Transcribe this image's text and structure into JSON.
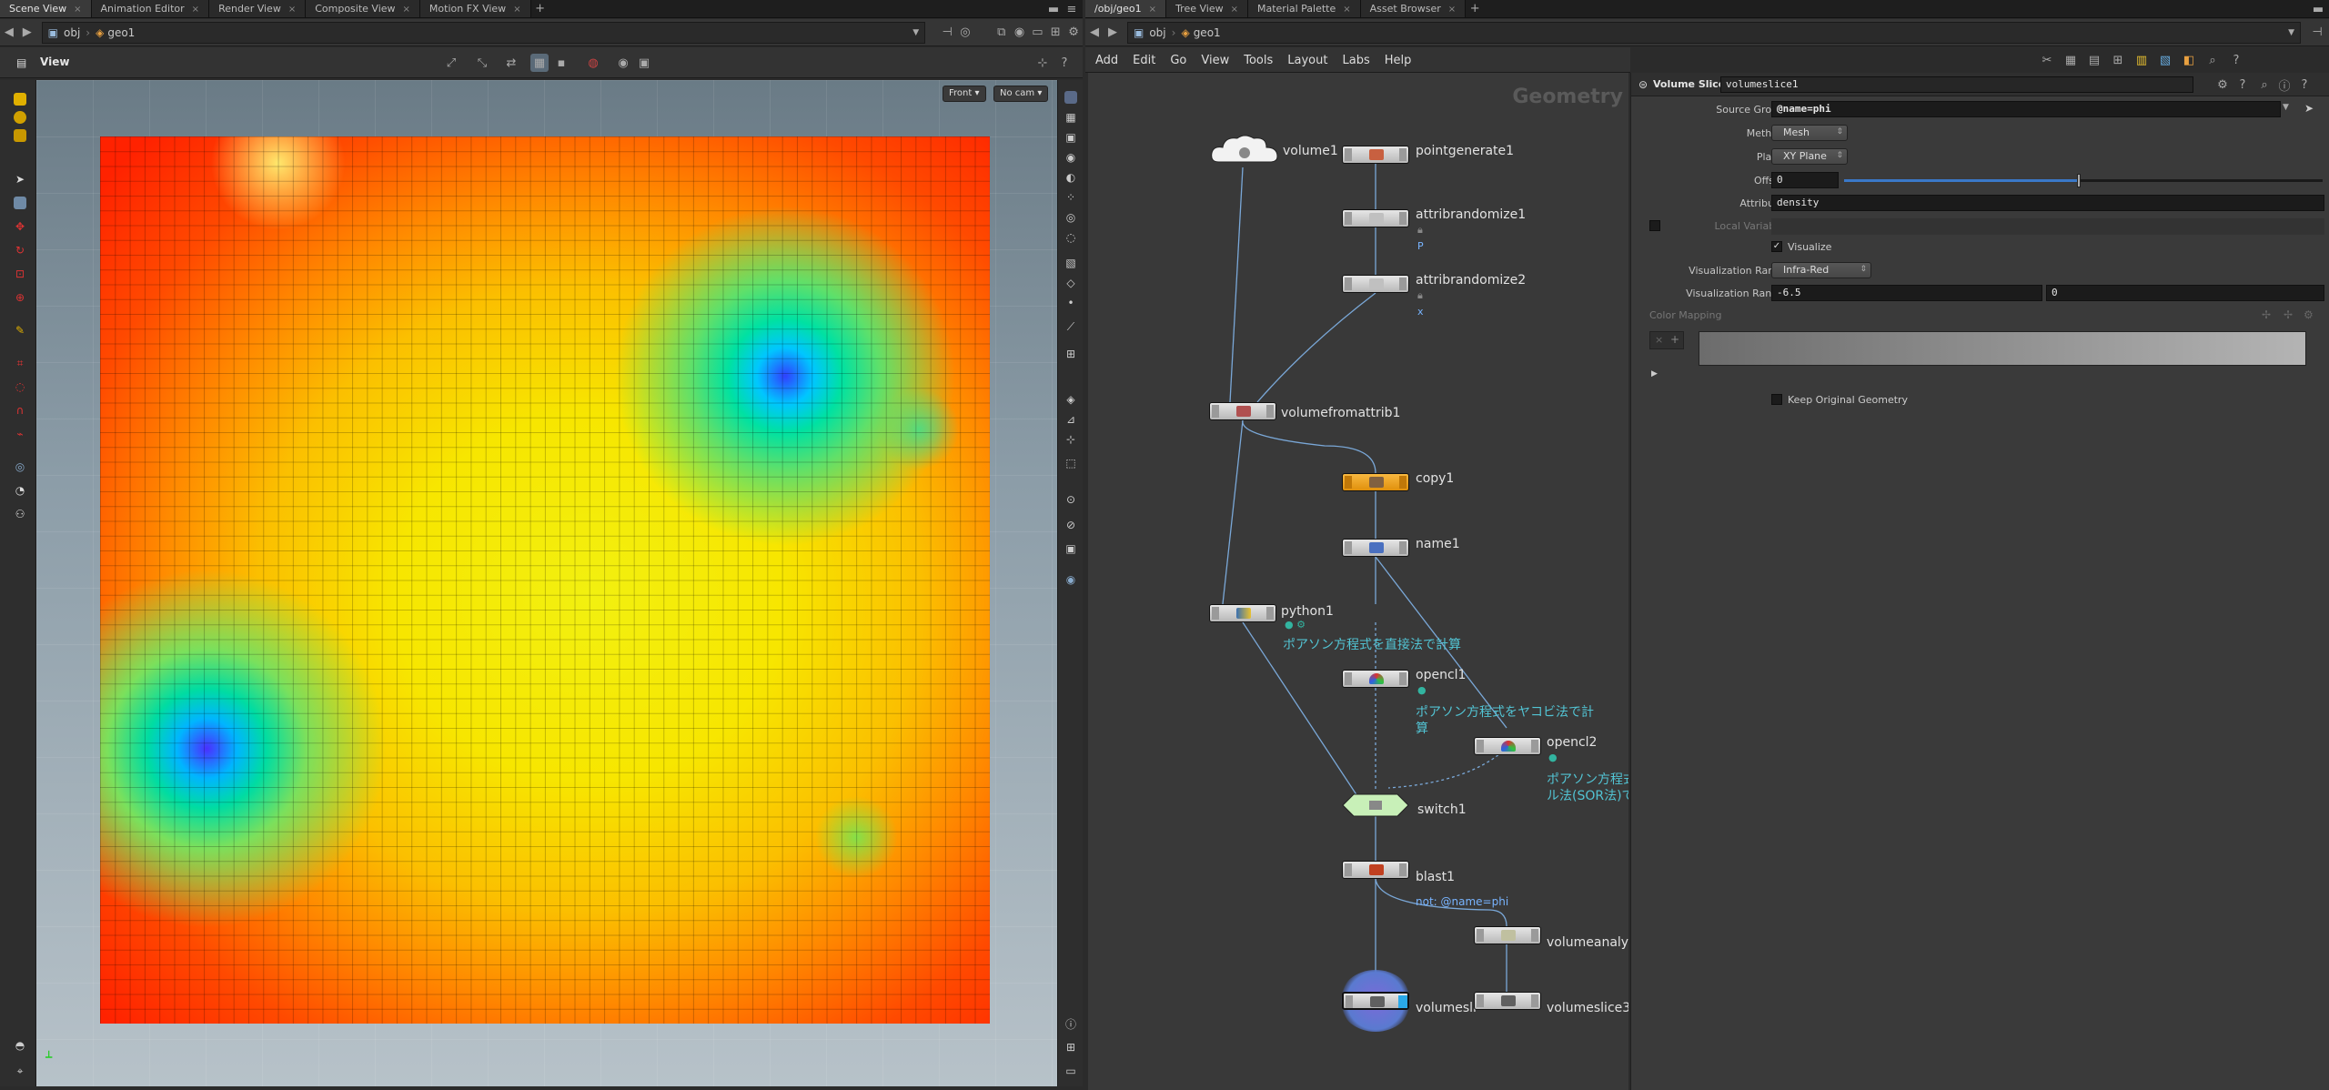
{
  "left_tabs": [
    "Scene View",
    "Animation Editor",
    "Render View",
    "Composite View",
    "Motion FX View"
  ],
  "right_tabs": [
    "/obj/geo1",
    "Tree View",
    "Material Palette",
    "Asset Browser"
  ],
  "left_path": {
    "obj": "obj",
    "geo": "geo1"
  },
  "right_path": {
    "obj": "obj",
    "geo": "geo1"
  },
  "viewer": {
    "title": "View",
    "view_menu": "Front ▾",
    "cam_menu": "No cam ▾"
  },
  "menu": [
    "Add",
    "Edit",
    "Go",
    "View",
    "Tools",
    "Layout",
    "Labs",
    "Help"
  ],
  "network": {
    "context": "Geometry",
    "nodes": {
      "volume1": "volume1",
      "pointgenerate1": "pointgenerate1",
      "attribrandomize1": "attribrandomize1",
      "attribrandomize1_sub": "P",
      "attribrandomize2": "attribrandomize2",
      "attribrandomize2_sub": "x",
      "volumefromattrib1": "volumefromattrib1",
      "copy1": "copy1",
      "name1": "name1",
      "python1": "python1",
      "python1_comment": "ポアソン方程式を直接法で計算",
      "opencl1": "opencl1",
      "opencl1_comment_1": "ポアソン方程式をヤコビ法で計",
      "opencl1_comment_2": "算",
      "opencl2": "opencl2",
      "opencl2_comment_1": "ポアソン方程式",
      "opencl2_comment_2": "ル法(SOR法)で",
      "switch1": "switch1",
      "blast1": "blast1",
      "blast1_sub": "not: @name=phi",
      "volumeanalysis": "volumeanalys",
      "volumeslice1": "volumesli",
      "volumeslice3": "volumeslice3"
    }
  },
  "params": {
    "node_type": "Volume Slice",
    "node_name": "volumeslice1",
    "source_group_label": "Source Group",
    "source_group": "@name=phi",
    "method_label": "Method",
    "method": "Mesh",
    "plane_label": "Plane",
    "plane": "XY Plane",
    "offset_label": "Offset",
    "offset": "0",
    "attribute_label": "Attribute",
    "attribute": "density",
    "local_variable": "Local Variable",
    "visualize": "Visualize",
    "viz_ramp_label": "Visualization Ramp",
    "viz_ramp": "Infra-Red",
    "viz_range_label": "Visualization Range",
    "viz_range_min": "-6.5",
    "viz_range_max": "0",
    "color_mapping": "Color Mapping",
    "keep_original": "Keep Original Geometry"
  },
  "colors": {
    "copy_node": "#f0a020",
    "switch_node": "#c8f0b8",
    "display_flag": "#2aa8e8",
    "wire": "#7aa8d8"
  }
}
